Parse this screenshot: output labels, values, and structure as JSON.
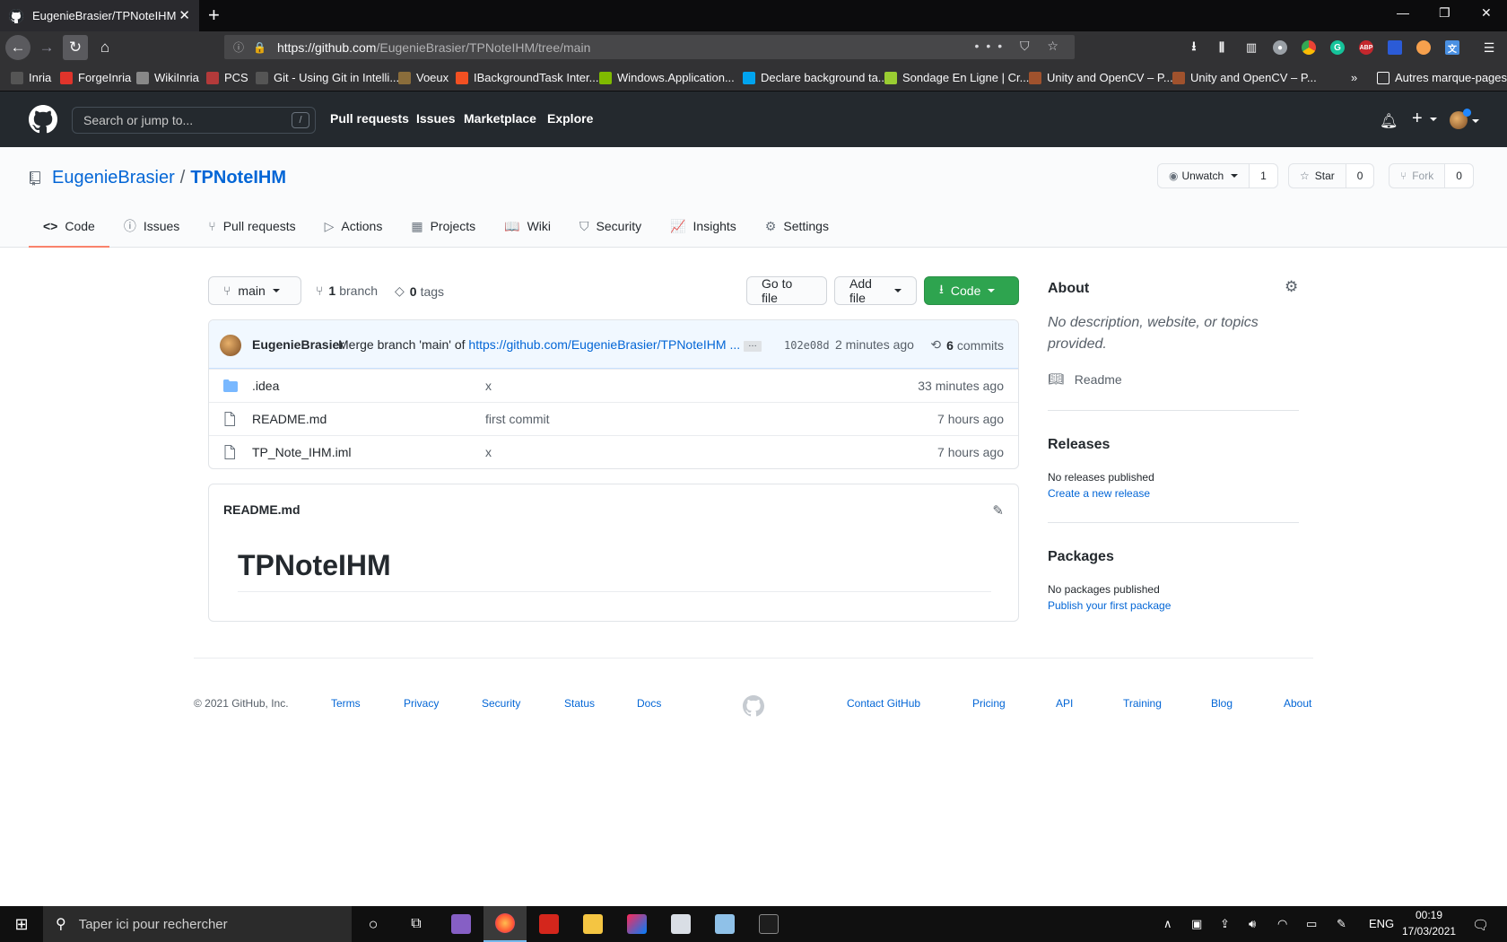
{
  "browser": {
    "tab_title": "EugenieBrasier/TPNoteIHM",
    "tab_close": "✕",
    "new_tab": "+",
    "url_host": "https://github.com",
    "url_path": "/EugenieBrasier/TPNoteIHM/tree/main",
    "bookmarks": [
      {
        "label": "Inria",
        "color": "#555555"
      },
      {
        "label": "ForgeInria",
        "color": "#e0342b"
      },
      {
        "label": "WikiInria",
        "color": "#888888"
      },
      {
        "label": "PCS",
        "color": "#b33a3a"
      },
      {
        "label": "Git - Using Git in Intelli...",
        "color": "#555555"
      },
      {
        "label": "Voeux",
        "color": "#8a6d3b"
      },
      {
        "label": "IBackgroundTask Inter...",
        "color": "#f25022"
      },
      {
        "label": "Windows.Application...",
        "color": "#7fba00"
      },
      {
        "label": "Declare background ta...",
        "color": "#00a4ef"
      },
      {
        "label": "Sondage En Ligne | Cr...",
        "color": "#9acd32"
      },
      {
        "label": "Unity and OpenCV – P...",
        "color": "#a0522d"
      },
      {
        "label": "Unity and OpenCV – P...",
        "color": "#a0522d"
      }
    ],
    "other_bookmarks": "Autres marque-pages"
  },
  "github": {
    "search_placeholder": "Search or jump to...",
    "search_shortcut": "/",
    "nav": [
      "Pull requests",
      "Issues",
      "Marketplace",
      "Explore"
    ],
    "plus": "+"
  },
  "repo": {
    "owner": "EugenieBrasier",
    "separator": "/",
    "name": "TPNoteIHM",
    "watch_label": "Unwatch",
    "watch_count": "1",
    "star_label": "Star",
    "star_count": "0",
    "fork_label": "Fork",
    "fork_count": "0",
    "tabs": [
      {
        "label": "Code",
        "icon": "<>"
      },
      {
        "label": "Issues",
        "icon": "ⓘ"
      },
      {
        "label": "Pull requests",
        "icon": "⑂"
      },
      {
        "label": "Actions",
        "icon": "▷"
      },
      {
        "label": "Projects",
        "icon": "▦"
      },
      {
        "label": "Wiki",
        "icon": "📖"
      },
      {
        "label": "Security",
        "icon": "⛉"
      },
      {
        "label": "Insights",
        "icon": "📈"
      },
      {
        "label": "Settings",
        "icon": "⚙"
      }
    ]
  },
  "toolbar": {
    "branch": "main",
    "branch_count": "1",
    "branch_word": "branch",
    "tag_count": "0",
    "tag_word": "tags",
    "go_to_file": "Go to file",
    "add_file": "Add file",
    "code": "Code"
  },
  "commit": {
    "author": "EugenieBrasier",
    "message": "Merge branch 'main' of ",
    "link": "https://github.com/EugenieBrasier/TPNoteIHM ...",
    "ellipsis": "…",
    "sha": "102e08d",
    "time": "2 minutes ago",
    "count": "6",
    "count_word": "commits"
  },
  "files": [
    {
      "type": "folder",
      "name": ".idea",
      "message": "x",
      "age": "33 minutes ago"
    },
    {
      "type": "file",
      "name": "README.md",
      "message": "first commit",
      "age": "7 hours ago"
    },
    {
      "type": "file",
      "name": "TP_Note_IHM.iml",
      "message": "x",
      "age": "7 hours ago"
    }
  ],
  "readme": {
    "filename": "README.md",
    "heading": "TPNoteIHM"
  },
  "sidebar": {
    "about_title": "About",
    "about_text_1": "No description, website, or topics",
    "about_text_2": "provided.",
    "readme_link": "Readme",
    "releases_title": "Releases",
    "releases_text": "No releases published",
    "releases_link": "Create a new release",
    "packages_title": "Packages",
    "packages_text": "No packages published",
    "packages_link": "Publish your first package"
  },
  "footer": {
    "copyright": "© 2021 GitHub, Inc.",
    "links_left": [
      "Terms",
      "Privacy",
      "Security",
      "Status",
      "Docs"
    ],
    "links_right": [
      "Contact GitHub",
      "Pricing",
      "API",
      "Training",
      "Blog",
      "About"
    ]
  },
  "taskbar": {
    "search_placeholder": "Taper ici pour rechercher",
    "lang": "ENG",
    "time": "00:19",
    "date": "17/03/2021"
  }
}
